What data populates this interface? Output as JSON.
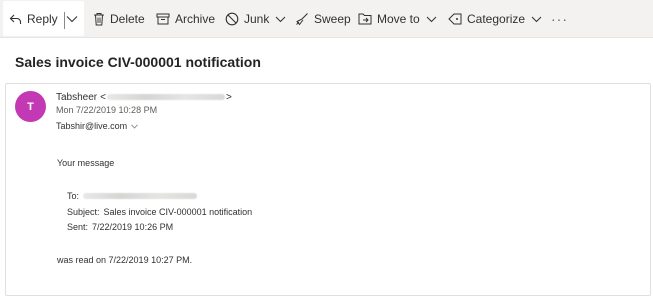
{
  "toolbar": {
    "reply_label": "Reply",
    "delete_label": "Delete",
    "archive_label": "Archive",
    "junk_label": "Junk",
    "sweep_label": "Sweep",
    "move_to_label": "Move to",
    "categorize_label": "Categorize",
    "more_label": "···"
  },
  "message": {
    "subject": "Sales invoice CIV-000001 notification",
    "sender_initial": "T",
    "sender_name": "Tabsheer",
    "sender_email_open": "<",
    "sender_email_close": ">",
    "date": "Mon 7/22/2019 10:28 PM",
    "recipient": "Tabshir@live.com",
    "body": {
      "intro": "Your message",
      "to_label": "To:",
      "subject_label": "Subject:",
      "subject_value": "Sales invoice CIV-000001 notification",
      "sent_label": "Sent:",
      "sent_value": "7/22/2019 10:26 PM",
      "outro": "was read on 7/22/2019 10:27 PM."
    }
  },
  "colors": {
    "toolbar_bg": "#f3f2f1",
    "avatar_bg": "#c239b3",
    "text": "#252423"
  },
  "icons": [
    "reply-icon",
    "chevron-down-icon",
    "delete-icon",
    "archive-icon",
    "junk-icon",
    "sweep-icon",
    "move-to-icon",
    "categorize-icon",
    "more-icon"
  ]
}
